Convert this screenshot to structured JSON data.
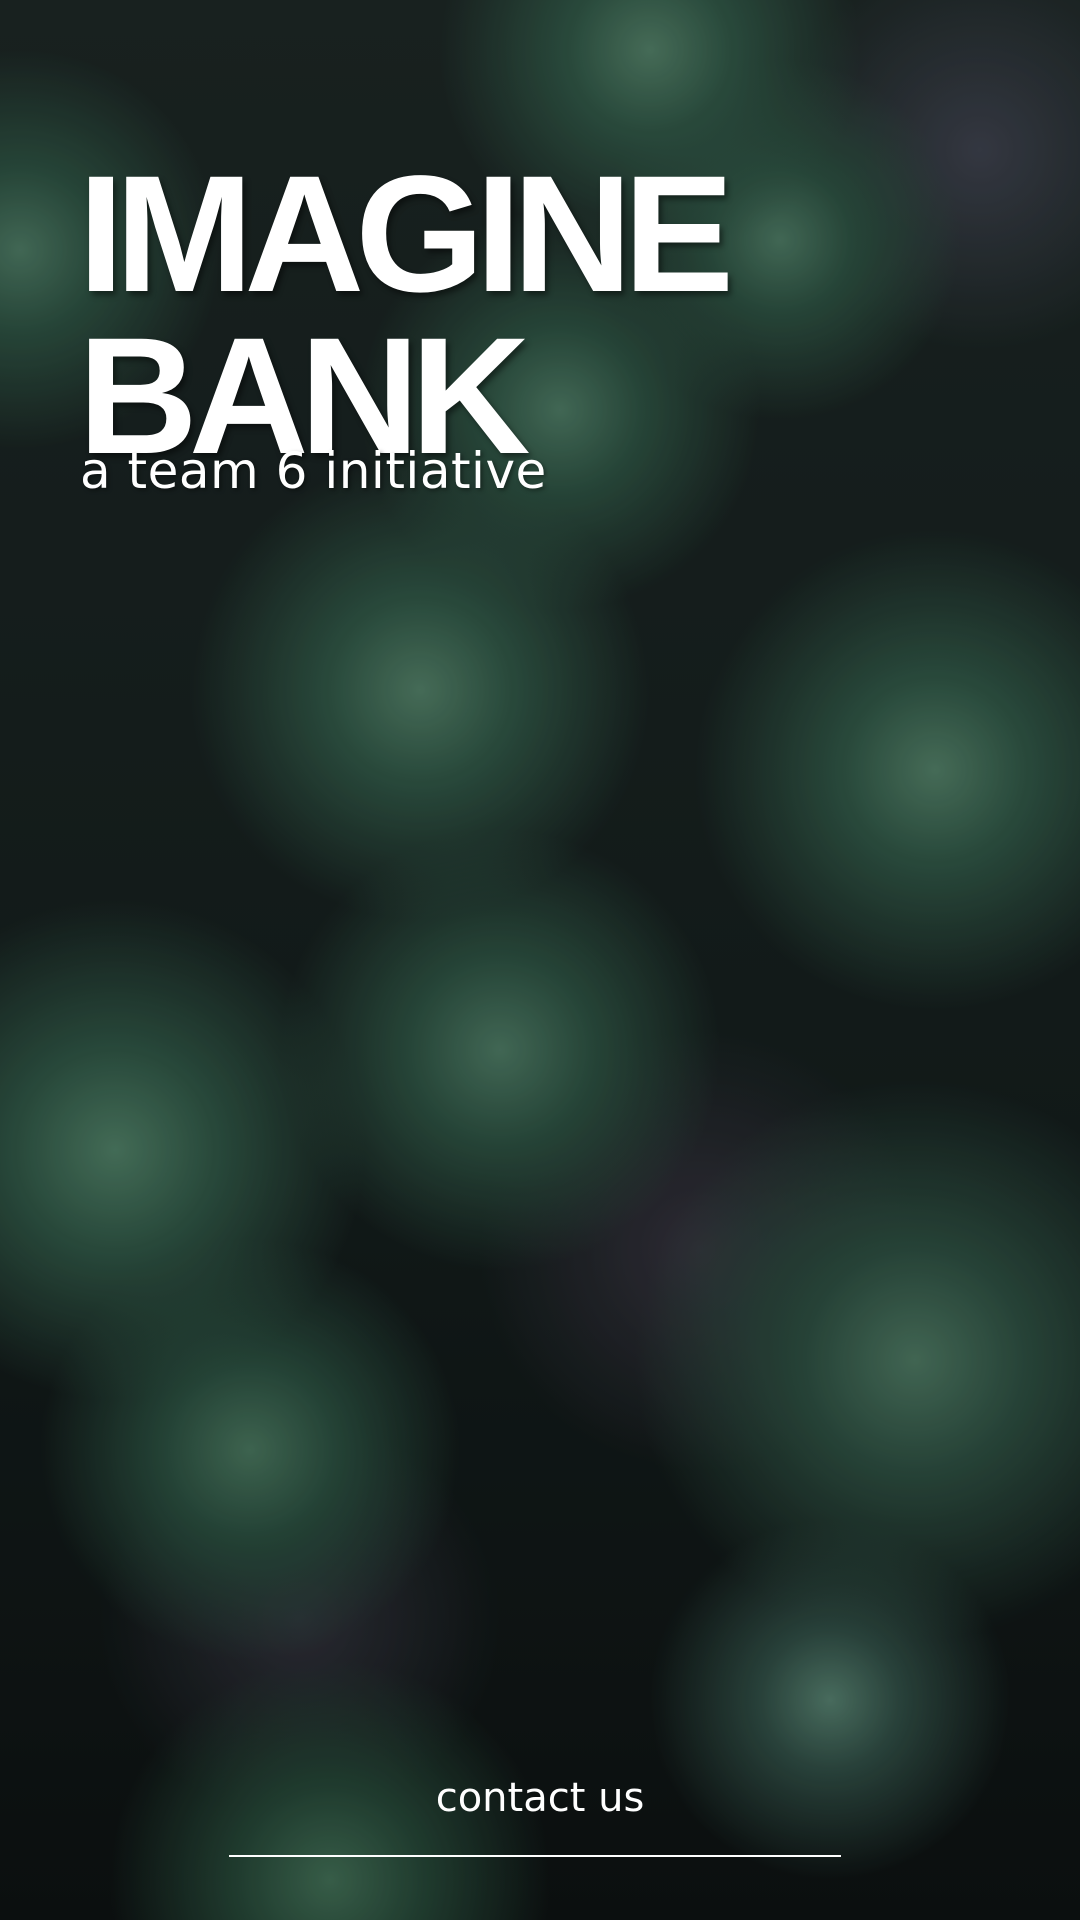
{
  "hero": {
    "title_line1": "IMAGINE",
    "title_line2": "BANK",
    "subtitle": "a team 6 initiative"
  },
  "footer": {
    "contact_label": "contact us"
  },
  "colors": {
    "text": "#ffffff",
    "background": "#1c2624"
  }
}
